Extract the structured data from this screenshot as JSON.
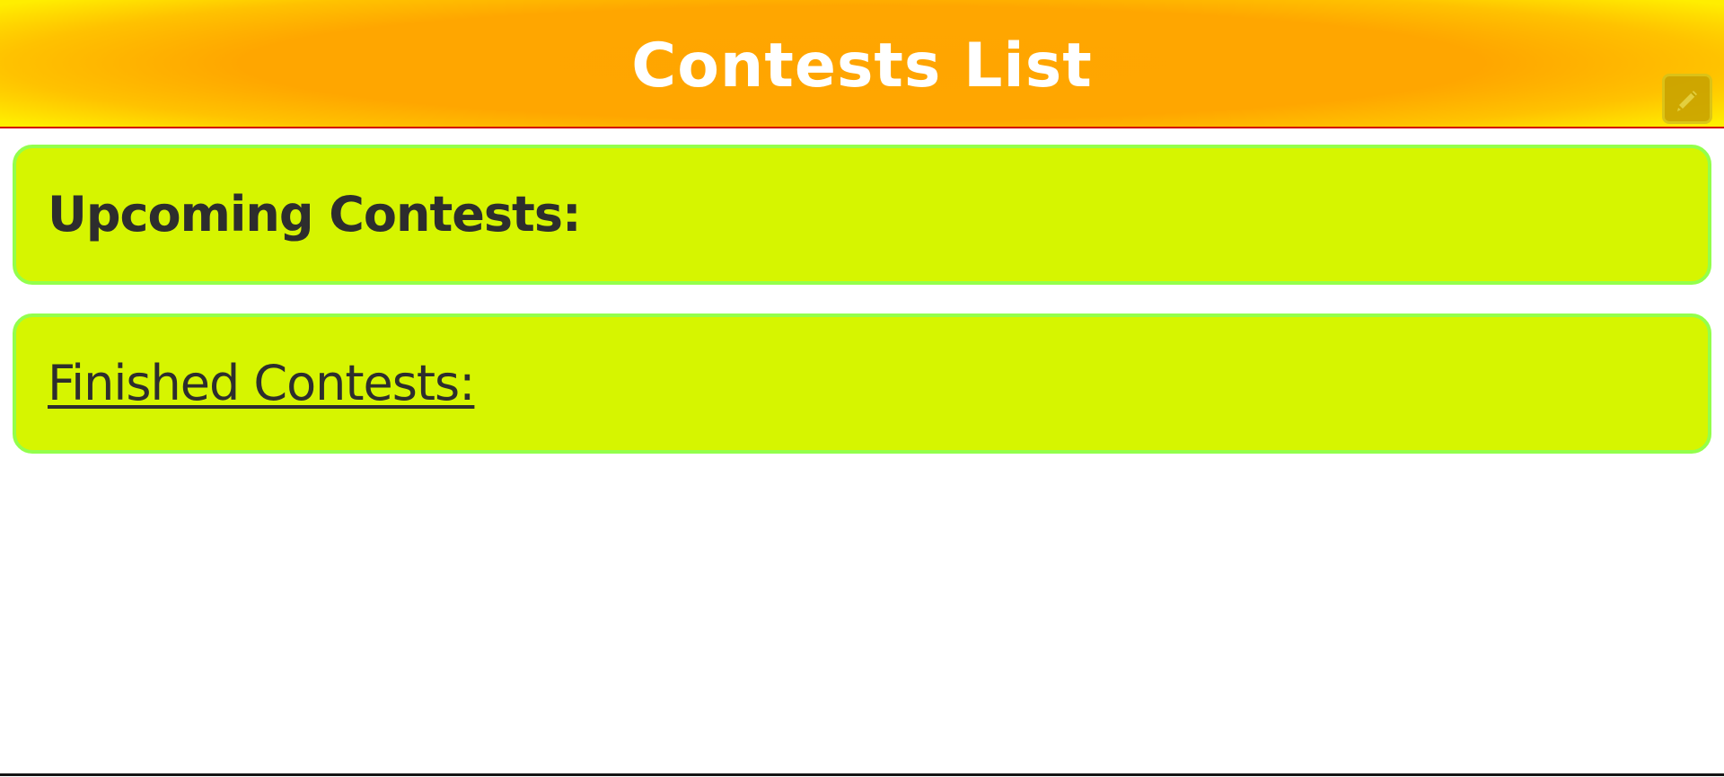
{
  "header": {
    "title": "Contests List",
    "toggle_icon": "pencil-icon",
    "colors": {
      "center": "#ffa500",
      "edge": "#ffee00",
      "border": "#d40000"
    }
  },
  "sections": {
    "upcoming": {
      "heading": "Upcoming Contests:"
    },
    "finished": {
      "heading": "Finished Contests:"
    }
  },
  "colors": {
    "card_fill": "#d6f500",
    "card_border": "#93ff4c",
    "heading_text": "#2d2d2d"
  }
}
